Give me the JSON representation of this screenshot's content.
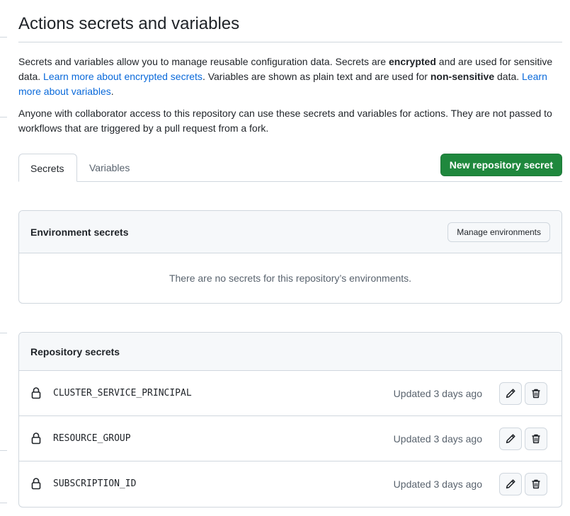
{
  "page": {
    "title": "Actions secrets and variables",
    "intro": {
      "part1": "Secrets and variables allow you to manage reusable configuration data. Secrets are ",
      "bold1": "encrypted",
      "part2": " and are used for sensitive data. ",
      "link1": "Learn more about encrypted secrets",
      "part3": ". Variables are shown as plain text and are used for ",
      "bold2": "non-sensitive",
      "part4": " data. ",
      "link2": "Learn more about variables",
      "part5": "."
    },
    "note": "Anyone with collaborator access to this repository can use these secrets and variables for actions. They are not passed to workflows that are triggered by a pull request from a fork."
  },
  "tabs": [
    {
      "label": "Secrets",
      "selected": true
    },
    {
      "label": "Variables",
      "selected": false
    }
  ],
  "new_secret_button": "New repository secret",
  "environment_secrets": {
    "title": "Environment secrets",
    "manage_button": "Manage environments",
    "empty_message": "There are no secrets for this repository’s environments."
  },
  "repository_secrets": {
    "title": "Repository secrets",
    "rows": [
      {
        "name": "CLUSTER_SERVICE_PRINCIPAL",
        "updated": "Updated 3 days ago",
        "icon": "lock-icon"
      },
      {
        "name": "RESOURCE_GROUP",
        "updated": "Updated 3 days ago",
        "icon": "lock-icon"
      },
      {
        "name": "SUBSCRIPTION_ID",
        "updated": "Updated 3 days ago",
        "icon": "lock-icon"
      }
    ]
  },
  "colors": {
    "primary_button": "#1f883d",
    "link": "#0969da",
    "border": "#d0d7de",
    "muted_text": "#59636e"
  }
}
